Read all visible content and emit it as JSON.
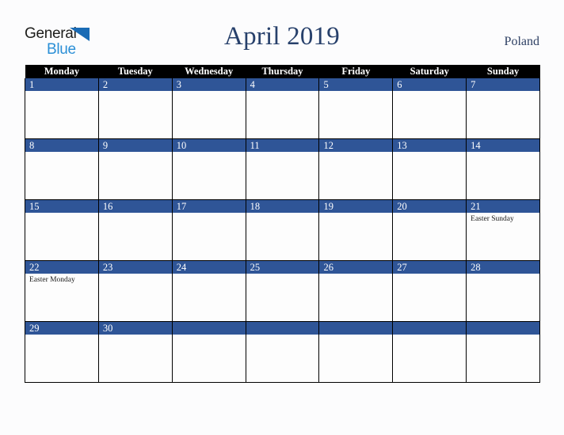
{
  "brand": {
    "name_part1": "General",
    "name_part2": "Blue",
    "triangle_icon": "triangle-icon",
    "color_dark": "#1d1d1b",
    "color_blue": "#2b8fd6",
    "triangle_color": "#1a6bb5"
  },
  "header": {
    "title": "April 2019",
    "country": "Poland",
    "title_color": "#27406b"
  },
  "calendar": {
    "weekday_headers": [
      "Monday",
      "Tuesday",
      "Wednesday",
      "Thursday",
      "Friday",
      "Saturday",
      "Sunday"
    ],
    "header_bg": "#000000",
    "daynum_bg": "#2f5597",
    "cell_bg": "#fdfdfd",
    "weeks": [
      [
        {
          "day": "1",
          "event": ""
        },
        {
          "day": "2",
          "event": ""
        },
        {
          "day": "3",
          "event": ""
        },
        {
          "day": "4",
          "event": ""
        },
        {
          "day": "5",
          "event": ""
        },
        {
          "day": "6",
          "event": ""
        },
        {
          "day": "7",
          "event": ""
        }
      ],
      [
        {
          "day": "8",
          "event": ""
        },
        {
          "day": "9",
          "event": ""
        },
        {
          "day": "10",
          "event": ""
        },
        {
          "day": "11",
          "event": ""
        },
        {
          "day": "12",
          "event": ""
        },
        {
          "day": "13",
          "event": ""
        },
        {
          "day": "14",
          "event": ""
        }
      ],
      [
        {
          "day": "15",
          "event": ""
        },
        {
          "day": "16",
          "event": ""
        },
        {
          "day": "17",
          "event": ""
        },
        {
          "day": "18",
          "event": ""
        },
        {
          "day": "19",
          "event": ""
        },
        {
          "day": "20",
          "event": ""
        },
        {
          "day": "21",
          "event": "Easter Sunday"
        }
      ],
      [
        {
          "day": "22",
          "event": "Easter Monday"
        },
        {
          "day": "23",
          "event": ""
        },
        {
          "day": "24",
          "event": ""
        },
        {
          "day": "25",
          "event": ""
        },
        {
          "day": "26",
          "event": ""
        },
        {
          "day": "27",
          "event": ""
        },
        {
          "day": "28",
          "event": ""
        }
      ],
      [
        {
          "day": "29",
          "event": ""
        },
        {
          "day": "30",
          "event": ""
        },
        {
          "day": "",
          "event": ""
        },
        {
          "day": "",
          "event": ""
        },
        {
          "day": "",
          "event": ""
        },
        {
          "day": "",
          "event": ""
        },
        {
          "day": "",
          "event": ""
        }
      ]
    ]
  }
}
